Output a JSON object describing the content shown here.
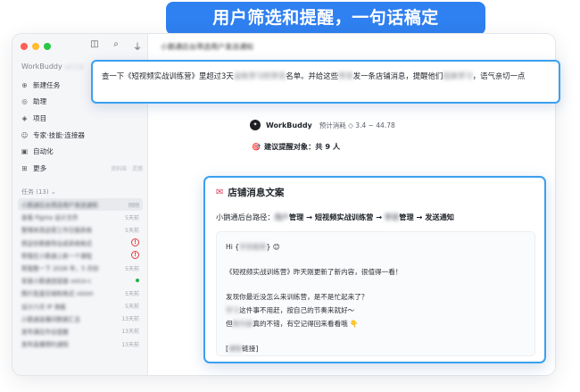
{
  "banner": {
    "text": "用户筛选和提醒，一句话稿定"
  },
  "sidebar": {
    "brand": "WorkBuddy",
    "version": "v0.3.8",
    "nav": [
      {
        "icon": "plus-circle-icon",
        "label": "新建任务",
        "right": ""
      },
      {
        "icon": "help-icon",
        "label": "助理",
        "right": ""
      },
      {
        "icon": "project-icon",
        "label": "项目",
        "right": ""
      },
      {
        "icon": "expert-icon",
        "label": "专家·技能·连接器",
        "right": ""
      },
      {
        "icon": "automation-icon",
        "label": "自动化",
        "right": ""
      },
      {
        "icon": "more-icon",
        "label": "更多",
        "right": "资料库 · 灵感"
      }
    ],
    "tasks_header": "任务 (13)",
    "tasks": [
      {
        "title": "小鹅通后台筛选用户发送通知",
        "time": "刚刚",
        "flag": ""
      },
      {
        "title": "查看 Figma 设计文件",
        "time": "5天前",
        "flag": ""
      },
      {
        "title": "整理本周运营工作日报表格",
        "time": "5天前",
        "flag": ""
      },
      {
        "title": "把这份数据导出成表格格式",
        "time": "",
        "flag": "alert"
      },
      {
        "title": "帮我在小鹅通上新一个课程",
        "time": "",
        "flag": "alert"
      },
      {
        "title": "帮我整一下 2026 年，5 月份",
        "time": "5天前",
        "flag": ""
      },
      {
        "title": "安装小鹅通连接器 voice-c",
        "time": "",
        "flag": "dot"
      },
      {
        "title": "图片批量压缩和格式 vision",
        "time": "5天前",
        "flag": ""
      },
      {
        "title": "设计六月 IP 海报",
        "time": "5天前",
        "flag": ""
      },
      {
        "title": "小鹅通直播间数据汇总",
        "time": "13天前",
        "flag": ""
      },
      {
        "title": "发布课后作业提醒",
        "time": "13天前",
        "flag": ""
      },
      {
        "title": "发布直播预约通知",
        "time": "13天前",
        "flag": ""
      }
    ]
  },
  "main": {
    "title": "小鹅通后台筛选用户发送通知",
    "workbuddy_name": "WorkBuddy",
    "cost_text": "预计消耗 ◇ 3.4 ~ 44.78",
    "suggest_text": "建议提醒对象：共 9 人"
  },
  "prompt": {
    "part1": "查一下《短视频实战训练营》里超过3天",
    "blur1": "没有学习的学员",
    "part2": "名单。并给这些",
    "blur2": "学员",
    "part3": "发一条店铺消息，提醒他们",
    "blur3": "回来学习",
    "part4": "，语气亲切一点"
  },
  "message": {
    "title": "店铺消息文案",
    "path_prefix": "小鹅通后台路径：",
    "path_blur1": "用户",
    "path_seg1": "管理 → 短视频实战训练营 → ",
    "path_blur2": "学员",
    "path_seg2": "管理 → 发送通知",
    "greet": "Hi {",
    "greet_blur": "学员昵称",
    "greet_end": "} 😊",
    "line1": "《短视频实战训练营》昨天刚更新了新内容，很值得一看！",
    "line2": "发现你最近没怎么来训练营，是不是忙起来了？",
    "line3_blur": "学习",
    "line3": "这件事不用赶，按自己的节奏来就好～",
    "line4_pre": "但",
    "line4_blur": "新内容",
    "line4": "真的不错，有空记得回来看看哦 👇",
    "link_pre": "[",
    "link_blur": "课程",
    "link_end": "链接]"
  }
}
